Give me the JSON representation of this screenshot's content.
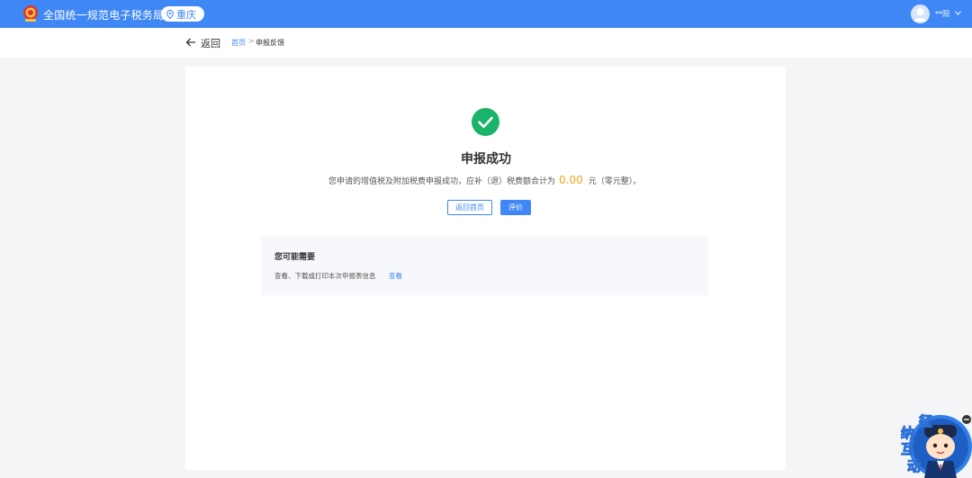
{
  "header": {
    "site_title": "全国统一规范电子税务局",
    "region": "重庆",
    "user_name": "**阳"
  },
  "nav": {
    "back_label": "返回",
    "breadcrumb": [
      "首页",
      "申报反馈"
    ],
    "separator": ">"
  },
  "result": {
    "title": "申报成功",
    "message_prefix": "您申请的增值税及附加税费申报成功，应补（退）税费额合计为",
    "amount": "0.00",
    "message_suffix": "元（零元整）。",
    "buttons": {
      "home": "返回首页",
      "rate": "评价"
    }
  },
  "tips": {
    "title": "您可能需要",
    "text": "查看、下载或打印本次申报表信息",
    "link": "查看"
  },
  "widget": {
    "chars": [
      "征",
      "纳",
      "互",
      "动"
    ]
  },
  "colors": {
    "brand": "#3f87f5",
    "success": "#1bb36a",
    "amount": "#f7a521"
  },
  "icons": {
    "emblem": "tax-emblem-icon",
    "pin": "location-pin-icon",
    "avatar": "user-avatar-icon",
    "caret": "chevron-down-icon",
    "back": "arrow-left-icon",
    "success": "check-circle-icon",
    "minimize": "minus-circle-icon"
  }
}
